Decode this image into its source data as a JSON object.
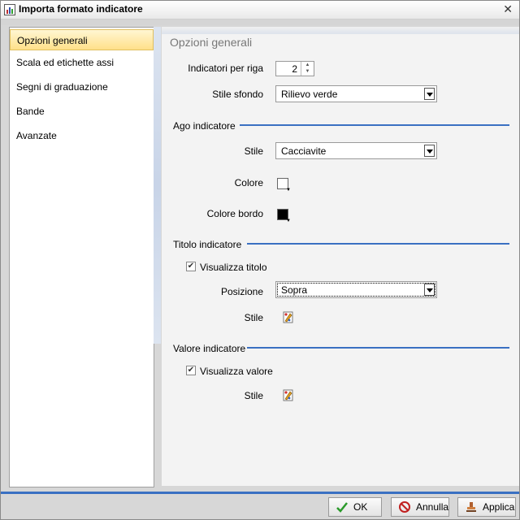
{
  "window": {
    "title": "Importa formato indicatore",
    "close_icon": "close-icon"
  },
  "nav": {
    "items": [
      {
        "label": "Opzioni generali",
        "selected": true
      },
      {
        "label": "Scala ed etichette assi"
      },
      {
        "label": "Segni di graduazione"
      },
      {
        "label": "Bande"
      },
      {
        "label": "Avanzate"
      }
    ]
  },
  "panel": {
    "title": "Opzioni generali",
    "indicators_per_row": {
      "label": "Indicatori per riga",
      "value": "2"
    },
    "background_style": {
      "label": "Stile sfondo",
      "value": "Rilievo verde"
    },
    "needle": {
      "group": "Ago indicatore",
      "style_label": "Stile",
      "style_value": "Cacciavite",
      "color_label": "Colore",
      "color_value": "#ffffff",
      "border_color_label": "Colore bordo",
      "border_color_value": "#000000"
    },
    "title_section": {
      "group": "Titolo indicatore",
      "show_label": "Visualizza titolo",
      "show_checked": true,
      "position_label": "Posizione",
      "position_value": "Sopra",
      "style_label": "Stile"
    },
    "value_section": {
      "group": "Valore indicatore",
      "show_label": "Visualizza valore",
      "show_checked": true,
      "style_label": "Stile"
    }
  },
  "footer": {
    "ok": "OK",
    "cancel": "Annulla",
    "apply": "Applica"
  },
  "colors": {
    "accent": "#3a70c2",
    "selection": "#ffe089"
  }
}
